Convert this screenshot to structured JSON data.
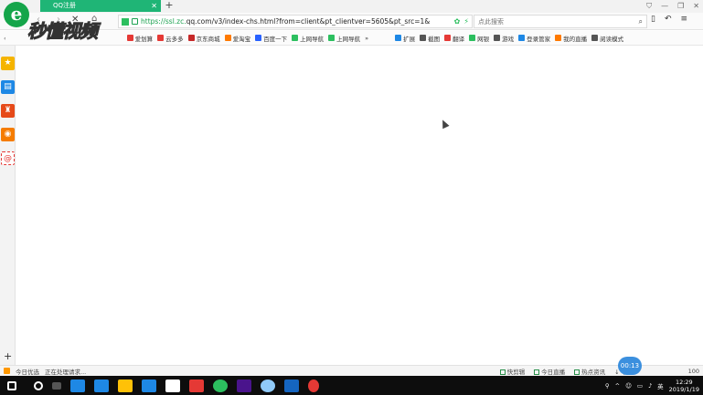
{
  "tab": {
    "title": "QQ注册",
    "close": "✕",
    "new": "+"
  },
  "window_controls": [
    "⛉",
    "—",
    "❐",
    "✕"
  ],
  "nav": {
    "back": "‹",
    "forward": "›",
    "stop": "✕",
    "home": "⌂"
  },
  "address": {
    "prefix": "https://",
    "host_prefix": "ssl.zc.",
    "host": "qq.com",
    "path": "/v3/index-chs.html?from=client&pt_clientver=5605&pt_src=1&"
  },
  "search": {
    "placeholder": "点此搜索",
    "icon": "search-icon"
  },
  "addr_right": [
    "▯",
    "↶",
    "≡"
  ],
  "bookmarks": [
    {
      "label": "爱划算",
      "color": "#e53935"
    },
    {
      "label": "云多多",
      "color": "#e53935"
    },
    {
      "label": "京东商城",
      "color": "#c62828"
    },
    {
      "label": "爱淘宝",
      "color": "#ff7a00"
    },
    {
      "label": "百度一下",
      "color": "#2962ff"
    },
    {
      "label": "上网导航",
      "color": "#2cbf5f"
    },
    {
      "label": "上网导航",
      "color": "#2cbf5f"
    }
  ],
  "bookmarks_more": "»",
  "bookbar_right": [
    {
      "label": "扩展",
      "color": "#1e88e5"
    },
    {
      "label": "截图",
      "color": "#555555"
    },
    {
      "label": "翻译",
      "color": "#e53935"
    },
    {
      "label": "网银",
      "color": "#2cbf5f"
    },
    {
      "label": "游戏",
      "color": "#555555"
    },
    {
      "label": "登录管家",
      "color": "#1e88e5"
    },
    {
      "label": "我的直播",
      "color": "#ff7a00"
    },
    {
      "label": "阅读模式",
      "color": "#555555"
    }
  ],
  "sidebar": [
    {
      "icon": "star-icon",
      "glyph": "★",
      "color": "#f5b400"
    },
    {
      "icon": "news-icon",
      "glyph": "▤",
      "color": "#1e88e5"
    },
    {
      "icon": "game-icon",
      "glyph": "♜",
      "color": "#e64a19"
    },
    {
      "icon": "weibo-icon",
      "glyph": "◉",
      "color": "#f57c00"
    },
    {
      "icon": "mail-icon",
      "glyph": "@",
      "color": "#e53935"
    }
  ],
  "sidebar_add": "+",
  "status": {
    "left_label": "今日优选",
    "message": "正在处理请求...",
    "right": [
      "快剪辑",
      "今日直播",
      "热点资讯",
      "下载"
    ],
    "zoom": "100",
    "timer": "00:13"
  },
  "taskbar": {
    "apps": [
      "#1e88e5",
      "#1e88e5",
      "#ffc107",
      "#1e88e5",
      "#ffffff",
      "#e53935",
      "#2cbf5f",
      "#6a1b9a",
      "#90caf9",
      "#1565c0",
      "#e53935"
    ],
    "ime": "英",
    "time": "12:29",
    "date": "2019/1/19"
  },
  "watermark": {
    "text": "秒懂视频",
    "logo": "e"
  }
}
